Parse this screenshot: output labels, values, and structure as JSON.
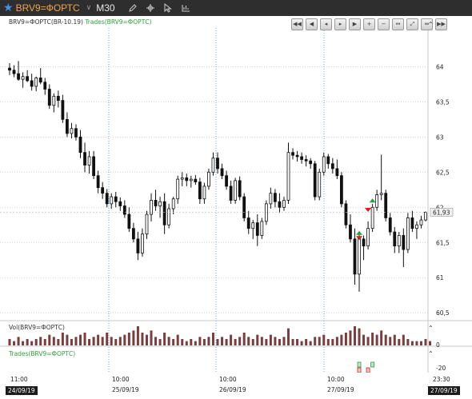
{
  "toolbar": {
    "symbol": "BRV9=ФОРТС",
    "timeframe": "M30",
    "tools": [
      "pencil-icon",
      "crosshair-icon",
      "cursor-icon",
      "indicators-icon"
    ]
  },
  "panels": {
    "price_label_symbol": "BRV9=ФОРТС(BR-10.19)",
    "price_label_trades": "Trades(BRV9=ФОРТС)",
    "volume_label": "Vol(BRV9=ФОРТС)",
    "trades_label": "Trades(BRV9=ФОРТС)"
  },
  "nav_buttons": [
    "first-icon",
    "prev-page-icon",
    "prev-icon",
    "next-icon",
    "next-page-icon",
    "zoom-in-icon",
    "zoom-out-icon",
    "fit-icon",
    "expand-icon",
    "compress-icon",
    "end-icon"
  ],
  "collapse_glyph": "⌃",
  "colors": {
    "up": "#ffffff",
    "down": "#111111",
    "volume": "#7a3e3e",
    "grid": "#d0d0d0",
    "vgrid": "#6aa8e0",
    "buy": "#2e9e3c",
    "sell": "#d11f1f",
    "current": "#f0f0f0"
  },
  "price_axis": {
    "ticks": [
      "64",
      "63,5",
      "63",
      "62,5",
      "62",
      "61,5",
      "61",
      "60,5"
    ],
    "current": "61,93"
  },
  "volume_axis": {
    "ticks": [
      "0"
    ]
  },
  "trades_axis": {
    "ticks": [
      "-20"
    ]
  },
  "time_axis": {
    "times": [
      {
        "label": "11:00"
      },
      {
        "label": "10:00"
      },
      {
        "label": "10:00"
      },
      {
        "label": "10:00"
      },
      {
        "label": "23:30"
      }
    ],
    "dates": [
      {
        "label": "24/09/19",
        "dark": true
      },
      {
        "label": "25/09/19",
        "dark": false
      },
      {
        "label": "26/09/19",
        "dark": false
      },
      {
        "label": "27/09/19",
        "dark": false
      },
      {
        "label": "27/09/19",
        "dark": true
      }
    ]
  },
  "chart_data": {
    "type": "candlestick",
    "price_range": [
      60.5,
      64.3
    ],
    "candles": [
      [
        63.98,
        64.05,
        63.88,
        63.95
      ],
      [
        63.95,
        64.02,
        63.85,
        63.9
      ],
      [
        63.9,
        64.08,
        63.8,
        63.82
      ],
      [
        63.82,
        63.92,
        63.7,
        63.86
      ],
      [
        63.86,
        63.95,
        63.78,
        63.8
      ],
      [
        63.8,
        63.9,
        63.66,
        63.72
      ],
      [
        63.72,
        63.86,
        63.65,
        63.84
      ],
      [
        63.84,
        63.98,
        63.75,
        63.78
      ],
      [
        63.78,
        63.84,
        63.6,
        63.68
      ],
      [
        63.68,
        63.75,
        63.4,
        63.45
      ],
      [
        63.45,
        63.62,
        63.35,
        63.58
      ],
      [
        63.58,
        63.66,
        63.42,
        63.52
      ],
      [
        63.52,
        63.6,
        63.2,
        63.25
      ],
      [
        63.25,
        63.35,
        63.0,
        63.05
      ],
      [
        63.05,
        63.2,
        62.98,
        63.12
      ],
      [
        63.12,
        63.18,
        62.95,
        63.0
      ],
      [
        63.0,
        63.1,
        62.7,
        62.78
      ],
      [
        62.78,
        62.92,
        62.5,
        62.6
      ],
      [
        62.6,
        62.8,
        62.48,
        62.72
      ],
      [
        62.72,
        62.8,
        62.4,
        62.45
      ],
      [
        62.45,
        62.52,
        62.2,
        62.28
      ],
      [
        62.28,
        62.36,
        62.12,
        62.2
      ],
      [
        62.2,
        62.26,
        62.0,
        62.05
      ],
      [
        62.05,
        62.2,
        61.98,
        62.15
      ],
      [
        62.15,
        62.22,
        62.0,
        62.08
      ],
      [
        62.08,
        62.14,
        61.95,
        62.02
      ],
      [
        62.02,
        62.1,
        61.85,
        61.9
      ],
      [
        61.9,
        62.0,
        61.65,
        61.7
      ],
      [
        61.7,
        61.78,
        61.5,
        61.55
      ],
      [
        61.55,
        61.65,
        61.25,
        61.35
      ],
      [
        61.35,
        61.7,
        61.3,
        61.62
      ],
      [
        61.62,
        61.95,
        61.55,
        61.9
      ],
      [
        61.9,
        62.2,
        61.8,
        62.1
      ],
      [
        62.1,
        62.25,
        61.95,
        62.02
      ],
      [
        62.02,
        62.15,
        61.85,
        62.08
      ],
      [
        62.08,
        62.2,
        61.62,
        61.75
      ],
      [
        61.75,
        62.05,
        61.7,
        61.98
      ],
      [
        61.98,
        62.15,
        61.9,
        62.12
      ],
      [
        62.12,
        62.45,
        62.05,
        62.4
      ],
      [
        62.4,
        62.5,
        62.3,
        62.42
      ],
      [
        62.42,
        62.48,
        62.3,
        62.38
      ],
      [
        62.38,
        62.45,
        62.28,
        62.4
      ],
      [
        62.4,
        62.46,
        62.32,
        62.36
      ],
      [
        62.36,
        62.42,
        62.05,
        62.12
      ],
      [
        62.12,
        62.35,
        62.05,
        62.3
      ],
      [
        62.3,
        62.55,
        62.25,
        62.5
      ],
      [
        62.5,
        62.78,
        62.45,
        62.7
      ],
      [
        62.7,
        62.78,
        62.48,
        62.55
      ],
      [
        62.55,
        62.62,
        62.4,
        62.45
      ],
      [
        62.45,
        62.52,
        62.25,
        62.3
      ],
      [
        62.3,
        62.38,
        62.05,
        62.1
      ],
      [
        62.1,
        62.42,
        62.05,
        62.38
      ],
      [
        62.38,
        62.44,
        62.1,
        62.15
      ],
      [
        62.15,
        62.2,
        61.8,
        61.85
      ],
      [
        61.85,
        61.95,
        61.62,
        61.7
      ],
      [
        61.7,
        61.82,
        61.55,
        61.78
      ],
      [
        61.78,
        61.9,
        61.45,
        61.6
      ],
      [
        61.6,
        61.85,
        61.55,
        61.8
      ],
      [
        61.8,
        62.1,
        61.75,
        62.05
      ],
      [
        62.05,
        62.28,
        61.98,
        62.2
      ],
      [
        62.2,
        62.26,
        62.0,
        62.08
      ],
      [
        62.08,
        62.2,
        61.92,
        62.0
      ],
      [
        62.0,
        62.15,
        61.95,
        62.1
      ],
      [
        62.1,
        62.92,
        62.05,
        62.78
      ],
      [
        62.78,
        62.84,
        62.68,
        62.74
      ],
      [
        62.74,
        62.8,
        62.65,
        62.72
      ],
      [
        62.72,
        62.78,
        62.62,
        62.68
      ],
      [
        62.68,
        62.74,
        62.58,
        62.66
      ],
      [
        62.66,
        62.7,
        62.55,
        62.62
      ],
      [
        62.62,
        62.66,
        62.1,
        62.15
      ],
      [
        62.15,
        62.55,
        62.1,
        62.5
      ],
      [
        62.5,
        62.78,
        62.45,
        62.72
      ],
      [
        62.72,
        62.76,
        62.55,
        62.62
      ],
      [
        62.62,
        62.7,
        62.48,
        62.55
      ],
      [
        62.55,
        62.68,
        62.4,
        62.45
      ],
      [
        62.45,
        62.5,
        62.0,
        62.05
      ],
      [
        62.05,
        62.1,
        61.7,
        61.75
      ],
      [
        61.75,
        61.9,
        61.5,
        61.55
      ],
      [
        61.55,
        61.7,
        60.9,
        61.05
      ],
      [
        61.05,
        61.65,
        60.8,
        61.55
      ],
      [
        61.55,
        61.6,
        61.25,
        61.45
      ],
      [
        61.45,
        61.8,
        61.4,
        61.7
      ],
      [
        61.7,
        62.05,
        61.65,
        62.0
      ],
      [
        62.0,
        62.25,
        61.95,
        62.18
      ],
      [
        62.18,
        62.75,
        62.1,
        62.2
      ],
      [
        62.2,
        62.25,
        61.8,
        61.85
      ],
      [
        61.85,
        61.92,
        61.6,
        61.65
      ],
      [
        61.65,
        61.72,
        61.35,
        61.45
      ],
      [
        61.45,
        61.65,
        61.35,
        61.6
      ],
      [
        61.6,
        61.7,
        61.15,
        61.4
      ],
      [
        61.4,
        61.92,
        61.35,
        61.85
      ],
      [
        61.85,
        61.95,
        61.65,
        61.7
      ],
      [
        61.7,
        61.8,
        61.55,
        61.75
      ],
      [
        61.75,
        61.88,
        61.7,
        61.82
      ],
      [
        61.82,
        61.94,
        61.8,
        61.93
      ]
    ],
    "volume": [
      3,
      2,
      4,
      2,
      3,
      2,
      3,
      4,
      3,
      5,
      4,
      3,
      6,
      5,
      3,
      4,
      5,
      6,
      3,
      4,
      5,
      4,
      6,
      4,
      3,
      4,
      5,
      6,
      7,
      9,
      6,
      5,
      7,
      4,
      3,
      6,
      4,
      3,
      5,
      3,
      2,
      3,
      2,
      4,
      3,
      4,
      6,
      3,
      4,
      3,
      5,
      3,
      4,
      6,
      4,
      3,
      5,
      4,
      3,
      5,
      4,
      3,
      4,
      8,
      3,
      3,
      2,
      3,
      2,
      4,
      4,
      5,
      3,
      3,
      4,
      5,
      6,
      7,
      9,
      8,
      5,
      4,
      6,
      5,
      7,
      5,
      4,
      5,
      3,
      5,
      3,
      2,
      2,
      2,
      3,
      2
    ],
    "trade_markers": [
      {
        "candle": 79,
        "side": "buy",
        "price": 61.62
      },
      {
        "candle": 79,
        "side": "sell",
        "price": 61.58
      },
      {
        "candle": 81,
        "side": "sell",
        "price": 61.98
      },
      {
        "candle": 82,
        "side": "buy",
        "price": 62.08
      }
    ]
  }
}
